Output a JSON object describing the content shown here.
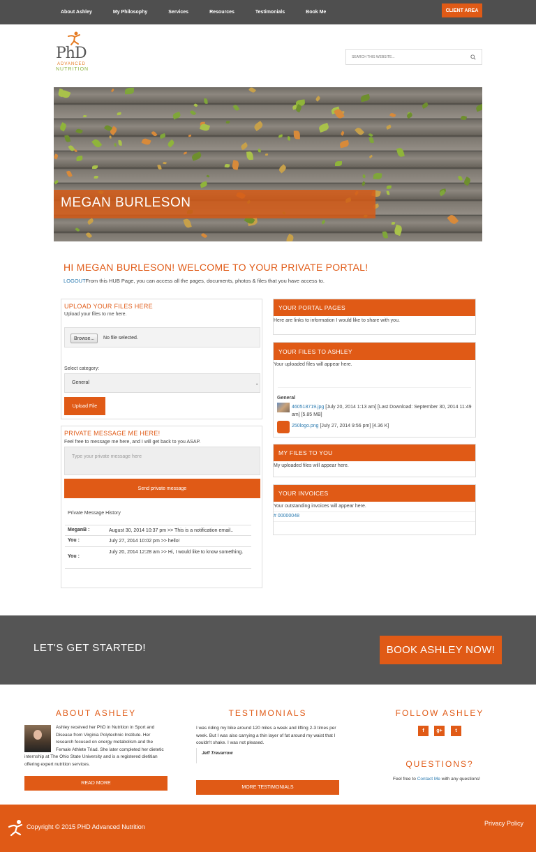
{
  "nav": {
    "items": [
      "About Ashley",
      "My Philosophy",
      "Services",
      "Resources",
      "Testimonials",
      "Book Me"
    ],
    "client_area": "CLIENT AREA"
  },
  "logo": {
    "main": "PhD",
    "line1": "ADVANCED",
    "line2": "NUTRITION"
  },
  "search": {
    "placeholder": "SEARCH THIS WEBSITE..."
  },
  "hero": {
    "name": "MEGAN BURLESON"
  },
  "welcome": {
    "title": "HI MEGAN BURLESON! WELCOME TO YOUR PRIVATE PORTAL!",
    "logout": "LOGOUT",
    "intro": "From this HUB Page, you can access all the pages, documents, photos & files that you have access to."
  },
  "upload": {
    "title": "UPLOAD YOUR FILES HERE",
    "subtitle": "Upload your files to me here.",
    "browse": "Browse...",
    "no_file": "No file selected.",
    "category_label": "Select category:",
    "category_value": "General",
    "button": "Upload File"
  },
  "message": {
    "title": "PRIVATE MESSAGE ME HERE!",
    "subtitle": "Feel free to message me here, and I will get back to you ASAP.",
    "placeholder": "Type your private message here",
    "send": "Send private message",
    "history_title": "Private Message History",
    "history": [
      {
        "who": "MeganB :",
        "msg": "August 30, 2014 10:37 pm >> This is a notification email.."
      },
      {
        "who": "You :",
        "msg": "July 27, 2014 10:02 pm >> hello!"
      },
      {
        "who": "You :",
        "msg": "July 20, 2014 12:28 am >> Hi, I would like to know something."
      }
    ]
  },
  "portal_pages": {
    "title": "YOUR PORTAL PAGES",
    "text": "Here are links to information I would like to share with you."
  },
  "files_to_ashley": {
    "title": "YOUR FILES TO ASHLEY",
    "text": "Your uploaded files will appear here.",
    "group": "General",
    "files": [
      {
        "name": "460518719.jpg",
        "meta": " [July 20, 2014 1:13 am] [Last Download: September 30, 2014 11:49 am] [5.85 MB]"
      },
      {
        "name": "250logo.png",
        "meta": " [July 27, 2014 9:56 pm] [4.36 K]"
      }
    ]
  },
  "files_to_you": {
    "title": "MY FILES TO YOU",
    "text": "My uploaded files will appear here."
  },
  "invoices": {
    "title": "YOUR INVOICES",
    "text": "Your outstanding invoices will appear here.",
    "invoice": "# 00000048"
  },
  "cta": {
    "text": "LET'S GET STARTED!",
    "button": "BOOK ASHLEY NOW!"
  },
  "about": {
    "title": "ABOUT ASHLEY",
    "text": "Ashley received her PhD in Nutrition in Sport and Disease from Virginia Polytechnic Institute. Her research focused on energy metabolism and the Female Athlete Triad. She later completed her dietetic internship at The Ohio State University and is a registered dietitian offering expert nutrition services.",
    "button": "READ MORE"
  },
  "testimonials": {
    "title": "TESTIMONIALS",
    "text": "I was riding my bike around 120 miles a week and lifting 2-3 times per week. But I was also carrying a thin layer of fat around my waist that I couldn't shake. I was not pleased.",
    "author": "Jeff Trevarrow",
    "button": "MORE TESTIMONIALS"
  },
  "follow": {
    "title": "FOLLOW ASHLEY",
    "icons": [
      "f",
      "g+",
      "t"
    ]
  },
  "questions": {
    "title": "QUESTIONS?",
    "pre": "Feel free to ",
    "link": "Contact Me",
    "post": " with any questions!"
  },
  "footer": {
    "copyright": "Copyright © 2015 PHD Advanced Nutrition",
    "privacy": "Privacy Policy"
  },
  "colors": {
    "accent": "#e05a16",
    "dark": "#4f4f4f",
    "link": "#2a7ab0"
  }
}
